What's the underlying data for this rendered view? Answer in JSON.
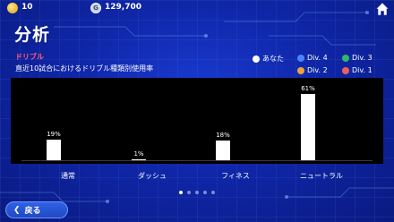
{
  "header": {
    "gold_amount": "10",
    "gem_amount": "129,700",
    "gem_symbol": "G"
  },
  "page_title": "分析",
  "section": {
    "title": "ドリブル",
    "subtitle": "直近10試合におけるドリブル種類別使用率"
  },
  "legend": [
    {
      "label": "あなた",
      "color": "#ffffff"
    },
    {
      "label": "Div. 4",
      "color": "#4a86ff"
    },
    {
      "label": "Div. 3",
      "color": "#2fb865"
    },
    {
      "label": "Div. 2",
      "color": "#f0a23a"
    },
    {
      "label": "Div. 1",
      "color": "#e8625a"
    }
  ],
  "chart_data": {
    "type": "bar",
    "categories": [
      "通常",
      "ダッシュ",
      "フィネス",
      "ニュートラル"
    ],
    "series": [
      {
        "name": "あなた",
        "values": [
          19,
          1,
          18,
          61
        ],
        "labels": [
          "19%",
          "1%",
          "18%",
          "61%"
        ]
      }
    ],
    "ylim": [
      0,
      61
    ]
  },
  "pager": {
    "count": 5,
    "active": 0
  },
  "back_button": {
    "label": "戻る"
  },
  "colors": {
    "accent": "#ff5b7a",
    "background": "#0f26a8"
  }
}
